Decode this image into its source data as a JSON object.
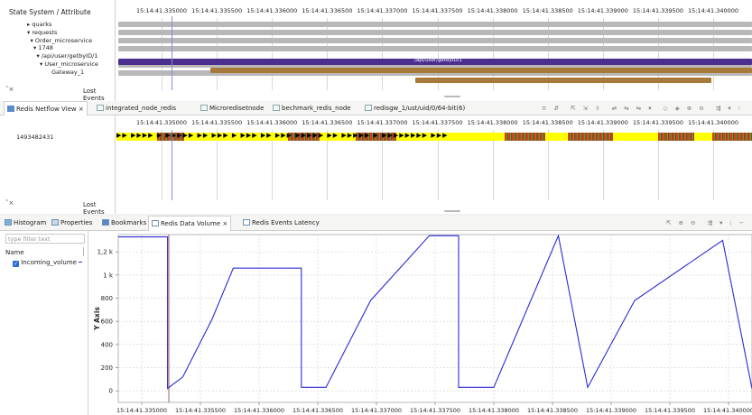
{
  "top_view": {
    "header": "State System / Attribute",
    "tree": [
      {
        "label": "quarks",
        "indent": 0,
        "mark": "▸"
      },
      {
        "label": "requests",
        "indent": 0,
        "mark": "▾"
      },
      {
        "label": "Order_microservice",
        "indent": 1,
        "mark": "▾"
      },
      {
        "label": "1748",
        "indent": 2,
        "mark": "▾"
      },
      {
        "label": "/api/user/getbyID/1",
        "indent": 3,
        "mark": "▾"
      },
      {
        "label": "User_microservice",
        "indent": 4,
        "mark": "▾"
      },
      {
        "label": "Gateway_1",
        "indent": 5,
        "mark": ""
      }
    ],
    "lost_events": "Lost Events",
    "state_label": "/api/user/getbyID/1"
  },
  "time_ticks": [
    "15:14:41.335000",
    "15:14:41.335500",
    "15:14:41.336000",
    "15:14:41.336500",
    "15:14:41.337000",
    "15:14:41.337500",
    "15:14:41.338000",
    "15:14:41.338500",
    "15:14:41.339000",
    "15:14:41.339500",
    "15:14:41.340000"
  ],
  "mid_view": {
    "tabs": [
      {
        "label": "Redis Netflow View",
        "active": true,
        "closable": true
      },
      {
        "label": "integrated_node_redis",
        "active": false
      },
      {
        "label": "Microredisetnode",
        "active": false
      },
      {
        "label": "bechmark_redis_node",
        "active": false
      },
      {
        "label": "redisgw_1/ust/uid/0/64-bit(6)",
        "active": false
      }
    ],
    "row_label": "1493482431",
    "lost_events": "Lost Events"
  },
  "bottom_view": {
    "tabs": [
      {
        "label": "Histogram",
        "icon": "histogram-icon"
      },
      {
        "label": "Properties",
        "icon": "properties-icon"
      },
      {
        "label": "Bookmarks",
        "icon": "bookmarks-icon"
      },
      {
        "label": "Redis Data Volume",
        "icon": "view-icon",
        "active": true,
        "closable": true
      },
      {
        "label": "Redis Events Latency",
        "icon": "view-icon"
      }
    ],
    "filter_placeholder": "type filter text",
    "legend_header": "Name",
    "legend_series": "Incoming_volume",
    "legend_checked": true
  },
  "chart_data": {
    "type": "line",
    "title": "",
    "xlabel": "",
    "ylabel": "Y Axis",
    "yticks": [
      "0",
      "200",
      "400",
      "600",
      "800",
      "1 k",
      "1,2 k"
    ],
    "ylim": [
      -100,
      1350
    ],
    "xlim": [
      0.3348,
      0.3402
    ],
    "series": [
      {
        "color": "#2b2bd4",
        "x": [
          0.3348,
          0.33522,
          0.33522,
          0.33535,
          0.3356,
          0.33578,
          0.33636,
          0.33636,
          0.33657,
          0.33657,
          0.33695,
          0.33745,
          0.33745,
          0.3377,
          0.3377,
          0.338,
          0.33855,
          0.33855,
          0.3388,
          0.3388,
          0.3392,
          0.33995,
          0.33995,
          0.3402
        ],
        "y": [
          1330,
          1330,
          20,
          120,
          620,
          1060,
          1060,
          30,
          30,
          30,
          780,
          1340,
          1340,
          1340,
          30,
          30,
          1340,
          1340,
          30,
          30,
          780,
          1300,
          1300,
          20
        ]
      }
    ]
  },
  "colors": {
    "accent_blue": "#2b2bd4",
    "purple_bar": "#4b2f8f",
    "brown_bar": "#a87a3a",
    "gray_bar": "#b8b8b8",
    "yellow": "#ffff00",
    "red": "#d83a1e"
  }
}
